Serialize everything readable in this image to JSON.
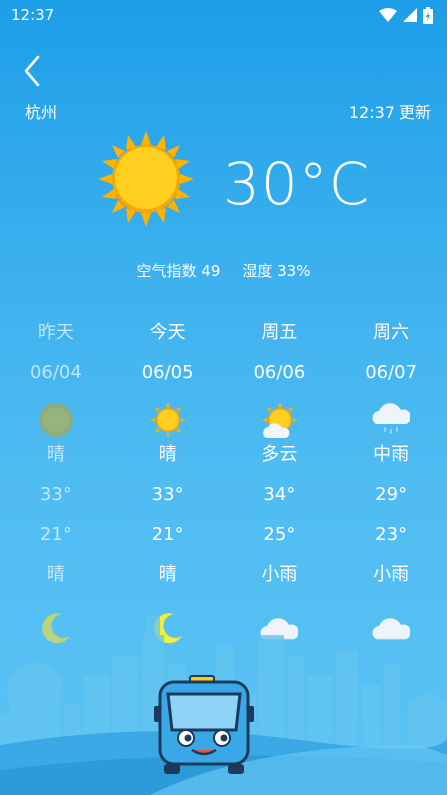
{
  "status": {
    "time": "12:37"
  },
  "header": {
    "city": "杭州",
    "update_time": "12:37",
    "update_label": "更新"
  },
  "current": {
    "temperature": "30°C",
    "aqi_label": "空气指数 49",
    "humidity_label": "湿度 33%",
    "icon": "sun-icon"
  },
  "forecast": [
    {
      "day": "昨天",
      "date": "06/04",
      "day_icon": "sun-icon",
      "day_weather": "晴",
      "high": "33°",
      "low": "21°",
      "night_weather": "晴",
      "night_icon": "moon-icon"
    },
    {
      "day": "今天",
      "date": "06/05",
      "day_icon": "sun-icon",
      "day_weather": "晴",
      "high": "33°",
      "low": "21°",
      "night_weather": "晴",
      "night_icon": "moon-icon"
    },
    {
      "day": "周五",
      "date": "06/06",
      "day_icon": "partly-cloudy-icon",
      "day_weather": "多云",
      "high": "34°",
      "low": "25°",
      "night_weather": "小雨",
      "night_icon": "cloud-icon"
    },
    {
      "day": "周六",
      "date": "06/07",
      "day_icon": "rain-cloud-icon",
      "day_weather": "中雨",
      "high": "29°",
      "low": "23°",
      "night_weather": "小雨",
      "night_icon": "cloud-icon"
    }
  ],
  "colors": {
    "sun": "#ffc21a",
    "sun_edge": "#f5a400",
    "moon": "#f4e94a",
    "cloud": "#e9f4fb",
    "bus": "#3aa8e6"
  }
}
